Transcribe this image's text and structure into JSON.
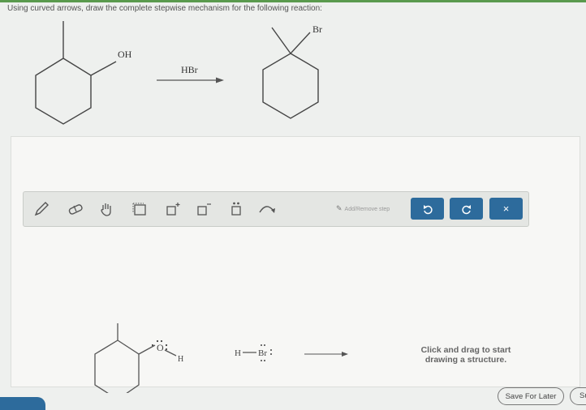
{
  "question": "Using curved arrows, draw the complete stepwise mechanism for the following reaction:",
  "reaction": {
    "reactant_group": "OH",
    "reagent": "HBr",
    "product_group": "Br"
  },
  "toolbar": {
    "add_remove_label": "Add/Remove step",
    "undo_icon": "undo-icon",
    "redo_icon": "redo-icon",
    "close_label": "×"
  },
  "drawing": {
    "oxygen_label": "O",
    "hydrogen_on_oxygen": "H",
    "hbr_h": "H",
    "hbr_br": "Br"
  },
  "hint": "Click and drag to start drawing a structure.",
  "buttons": {
    "save_for_later": "Save For Later",
    "submit": "Su"
  },
  "colors": {
    "accent": "#2d6b9c",
    "header": "#5a9a4e"
  }
}
